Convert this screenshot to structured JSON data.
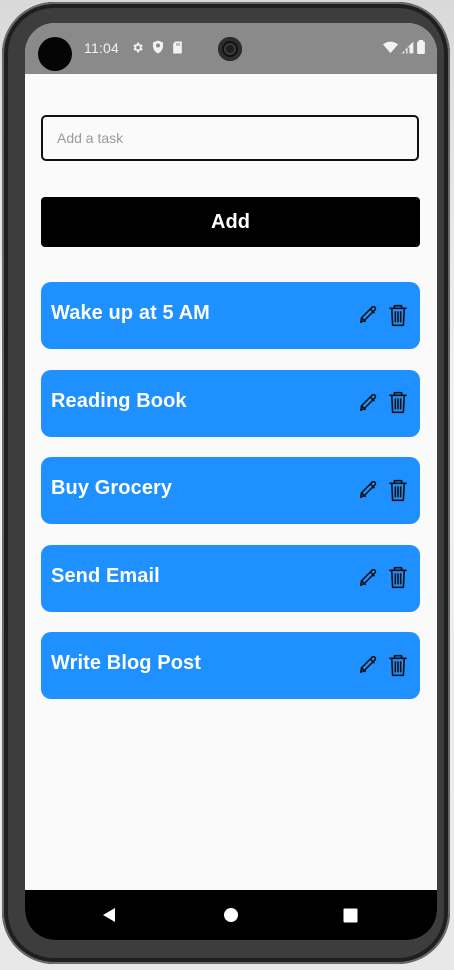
{
  "status_bar": {
    "time": "11:04",
    "left_icons": [
      "gear-icon",
      "shield-icon",
      "sd-card-icon"
    ],
    "right_icons": [
      "wifi-icon",
      "cell-signal-icon",
      "battery-icon"
    ]
  },
  "task_form": {
    "input_value": "",
    "placeholder": "Add a task",
    "add_label": "Add"
  },
  "tasks": [
    {
      "label": "Wake up at 5 AM",
      "actions": [
        "pencil-icon",
        "trash-icon"
      ]
    },
    {
      "label": "Reading Book",
      "actions": [
        "pencil-icon",
        "trash-icon"
      ]
    },
    {
      "label": "Buy Grocery",
      "actions": [
        "pencil-icon",
        "trash-icon"
      ]
    },
    {
      "label": "Send Email",
      "actions": [
        "pencil-icon",
        "trash-icon"
      ]
    },
    {
      "label": "Write Blog Post",
      "actions": [
        "pencil-icon",
        "trash-icon"
      ]
    }
  ],
  "navigation": {
    "icons": [
      "back-icon",
      "home-icon",
      "recent-apps-icon"
    ]
  },
  "colors": {
    "task_card": "#1E90FF",
    "add_button": "#000000",
    "background": "#FAFAFA",
    "status_bar": "#8A8A8A"
  }
}
